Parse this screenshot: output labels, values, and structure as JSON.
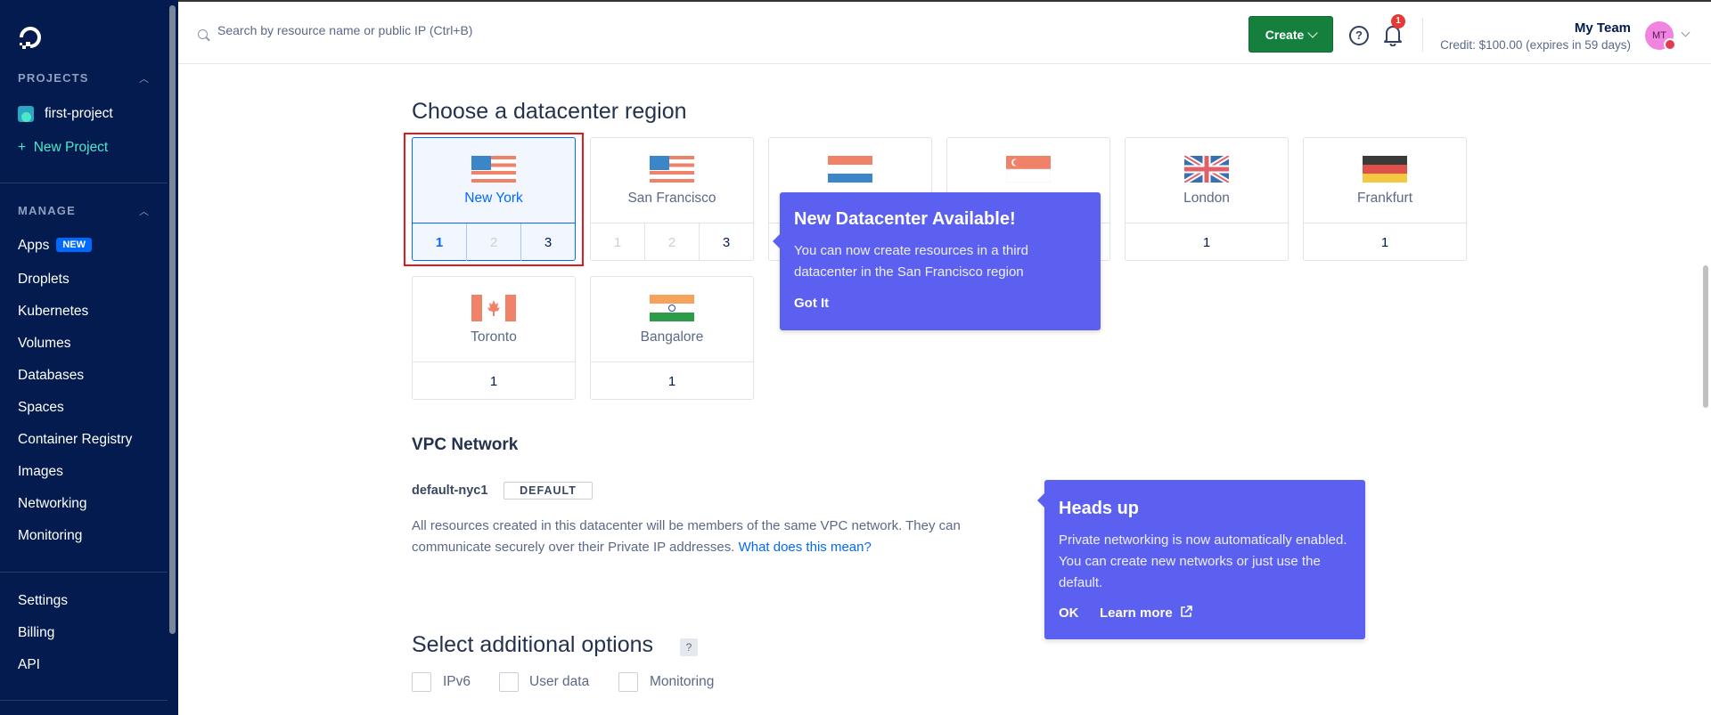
{
  "sidebar": {
    "projects_heading": "PROJECTS",
    "projects": [
      {
        "label": "first-project"
      }
    ],
    "new_project": "New Project",
    "manage_heading": "MANAGE",
    "manage_items": [
      {
        "label": "Apps",
        "badge": "NEW"
      },
      {
        "label": "Droplets"
      },
      {
        "label": "Kubernetes"
      },
      {
        "label": "Volumes"
      },
      {
        "label": "Databases"
      },
      {
        "label": "Spaces"
      },
      {
        "label": "Container Registry"
      },
      {
        "label": "Images"
      },
      {
        "label": "Networking"
      },
      {
        "label": "Monitoring"
      }
    ],
    "bottom_items": [
      {
        "label": "Settings"
      },
      {
        "label": "Billing"
      },
      {
        "label": "API"
      }
    ]
  },
  "topbar": {
    "search_placeholder": "Search by resource name or public IP (Ctrl+B)",
    "create_label": "Create",
    "notification_count": "1",
    "team_name": "My Team",
    "credit": "Credit: $100.00 (expires in 59 days)",
    "avatar_initials": "MT"
  },
  "region": {
    "heading": "Choose a datacenter region",
    "cards": [
      {
        "city": "New York",
        "flag": "us-flag",
        "numbers": [
          "1",
          "2",
          "3"
        ]
      },
      {
        "city": "San Francisco",
        "flag": "us-flag",
        "numbers": [
          "1",
          "2",
          "3"
        ]
      },
      {
        "city": "",
        "flag": "netherlands-flag",
        "numbers": [
          ""
        ]
      },
      {
        "city": "",
        "flag": "singapore-flag",
        "numbers": [
          ""
        ]
      },
      {
        "city": "London",
        "flag": "uk-flag",
        "numbers": [
          "1"
        ]
      },
      {
        "city": "Frankfurt",
        "flag": "germany-flag",
        "numbers": [
          "1"
        ]
      },
      {
        "city": "Toronto",
        "flag": "canada-flag",
        "numbers": [
          "1"
        ]
      },
      {
        "city": "Bangalore",
        "flag": "india-flag",
        "numbers": [
          "1"
        ]
      }
    ]
  },
  "tooltip_datacenter": {
    "title": "New Datacenter Available!",
    "body": "You can now create resources in a third datacenter in the San Francisco region",
    "action": "Got It"
  },
  "vpc": {
    "heading": "VPC Network",
    "name": "default-nyc1",
    "badge": "DEFAULT",
    "description": "All resources created in this datacenter will be members of the same VPC network. They can communicate securely over their Private IP addresses.",
    "link": "What does this mean?"
  },
  "tooltip_headsup": {
    "title": "Heads up",
    "body": "Private networking is now automatically enabled. You can create new networks or just use the default.",
    "ok": "OK",
    "learn_more": "Learn more"
  },
  "options": {
    "heading": "Select additional options",
    "help": "?",
    "items": [
      {
        "label": "IPv6"
      },
      {
        "label": "User data"
      },
      {
        "label": "Monitoring"
      }
    ]
  },
  "colors": {
    "sidebar_bg": "#031b4e",
    "accent": "#0069ff",
    "create_button": "#15803d",
    "tooltip_bg": "#5c60f0",
    "selection_outline": "#e0191e"
  }
}
